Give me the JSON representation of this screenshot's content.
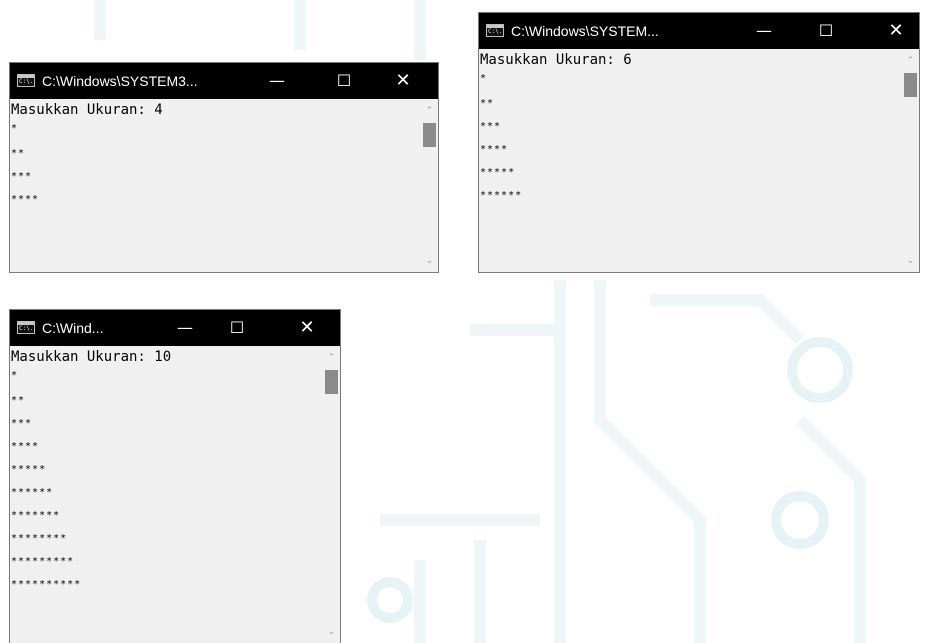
{
  "consoles": [
    {
      "title": "C:\\Windows\\SYSTEM3...",
      "prompt": "Masukkan Ukuran: 4",
      "rows": [
        "*",
        "**",
        "***",
        "****"
      ]
    },
    {
      "title": "C:\\Windows\\SYSTEM...",
      "prompt": "Masukkan Ukuran: 6",
      "rows": [
        "*",
        "**",
        "***",
        "****",
        "*****",
        "******"
      ]
    },
    {
      "title": "C:\\Wind...",
      "prompt": "Masukkan Ukuran: 10",
      "rows": [
        "*",
        "**",
        "***",
        "****",
        "*****",
        "******",
        "*******",
        "********",
        "*********",
        "**********"
      ]
    }
  ],
  "window_controls": {
    "minimize": "—",
    "maximize": "☐",
    "close": "✕"
  },
  "app_icon_text": "C:\\.",
  "scroll_up": "⌃",
  "scroll_down": "⌄",
  "colors": {
    "titlebar": "#000000",
    "console_bg": "#f0f0f0",
    "scroll_thumb": "#8a8a8a"
  }
}
